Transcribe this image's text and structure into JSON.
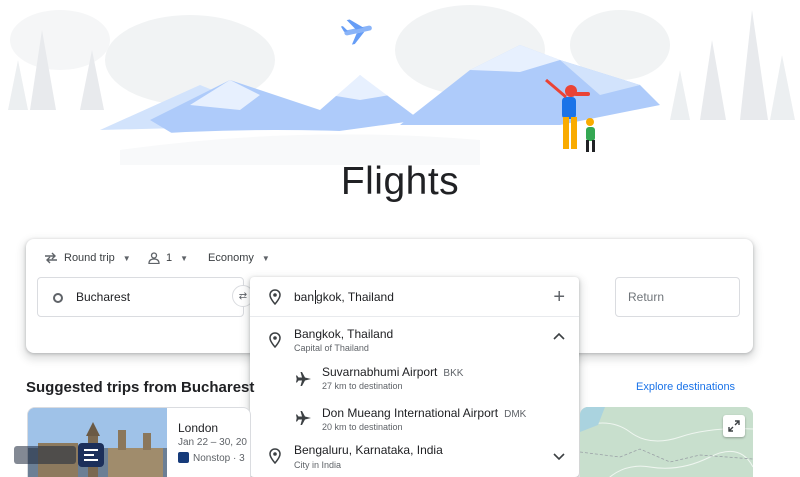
{
  "page": {
    "title": "Flights"
  },
  "trip_options": {
    "trip_type": "Round trip",
    "passengers": "1",
    "cabin_class": "Economy"
  },
  "search": {
    "origin": "Bucharest",
    "destination_typed_before_cursor": "ban",
    "destination_typed_after_cursor": "gkok, Thailand",
    "return_placeholder": "Return"
  },
  "dropdown": {
    "items": [
      {
        "name": "Bangkok, Thailand",
        "sub": "Capital of Thailand",
        "icon": "location-pin-icon",
        "expanded": true
      },
      {
        "name": "Suvarnabhumi Airport",
        "code": "BKK",
        "sub": "27 km to destination",
        "icon": "airplane-icon"
      },
      {
        "name": "Don Mueang International Airport",
        "code": "DMK",
        "sub": "20 km to destination",
        "icon": "airplane-icon"
      },
      {
        "name": "Bengaluru, Karnataka, India",
        "sub": "City in India",
        "icon": "location-pin-icon",
        "expanded": false
      }
    ]
  },
  "suggested": {
    "title": "Suggested trips from Bucharest",
    "explore_link": "Explore destinations",
    "trips": [
      {
        "city": "London",
        "dates": "Jan 22 – 30, 20",
        "stops": "Nonstop · 3"
      }
    ]
  },
  "colors": {
    "accent": "#1a73e8",
    "text": "#202124",
    "secondary_text": "#5f6368",
    "border": "#dadce0",
    "mountain_blue": "#aecbfa",
    "map_green": "#bfd8c7"
  }
}
